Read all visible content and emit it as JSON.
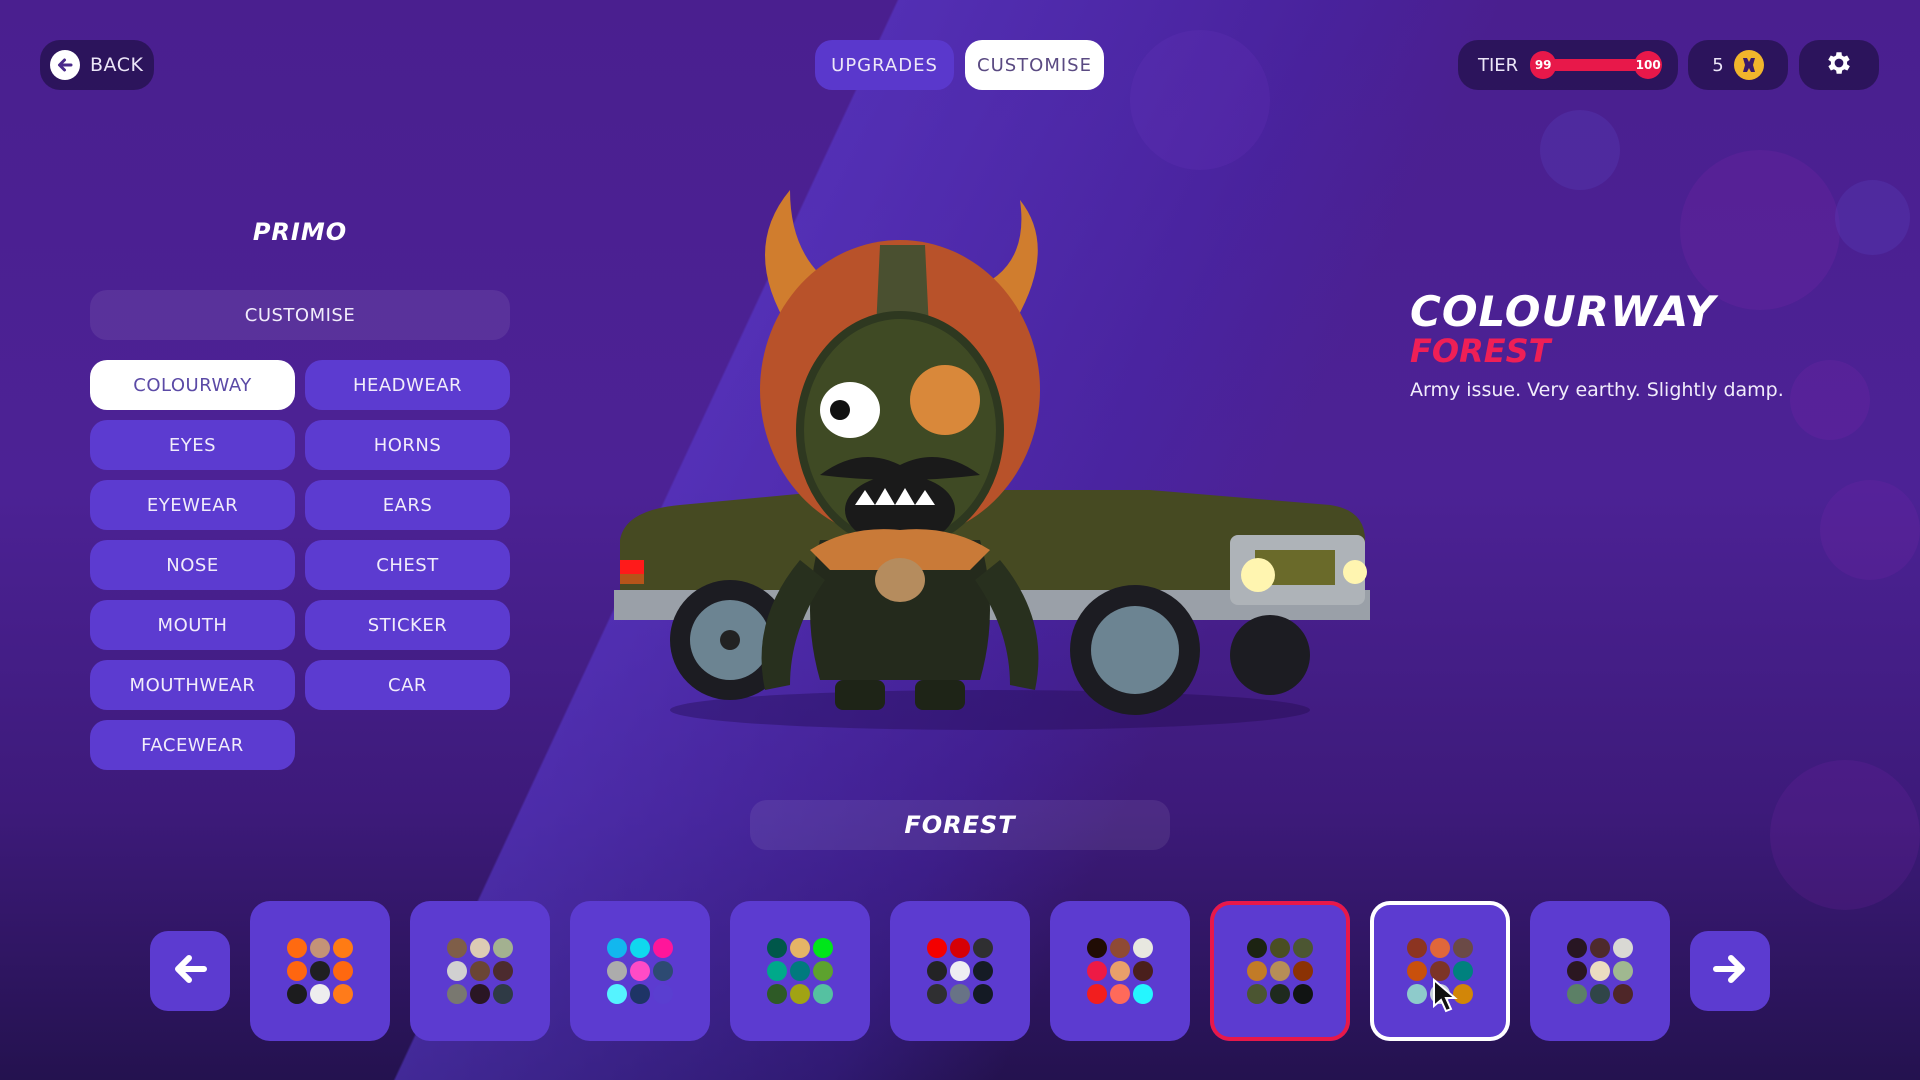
{
  "header": {
    "back_label": "BACK",
    "tabs": [
      {
        "label": "UPGRADES",
        "active": false
      },
      {
        "label": "CUSTOMISE",
        "active": true
      }
    ],
    "tier": {
      "label": "TIER",
      "current": "99",
      "next": "100",
      "progress": 1.0
    },
    "coins": "5",
    "icons": {
      "back": "arrow-left-circle-icon",
      "coin": "coin-icon",
      "settings": "gear-icon"
    }
  },
  "left_panel": {
    "character_name": "PRIMO",
    "section_label": "CUSTOMISE",
    "categories": [
      {
        "label": "COLOURWAY",
        "active": true
      },
      {
        "label": "HEADWEAR",
        "active": false
      },
      {
        "label": "EYES",
        "active": false
      },
      {
        "label": "HORNS",
        "active": false
      },
      {
        "label": "EYEWEAR",
        "active": false
      },
      {
        "label": "EARS",
        "active": false
      },
      {
        "label": "NOSE",
        "active": false
      },
      {
        "label": "CHEST",
        "active": false
      },
      {
        "label": "MOUTH",
        "active": false
      },
      {
        "label": "STICKER",
        "active": false
      },
      {
        "label": "MOUTHWEAR",
        "active": false
      },
      {
        "label": "CAR",
        "active": false
      },
      {
        "label": "FACEWEAR",
        "active": false
      }
    ]
  },
  "detail": {
    "title": "COLOURWAY",
    "subtitle": "FOREST",
    "description": "Army issue. Very earthy. Slightly damp."
  },
  "scene": {
    "description": "horned monster character in helmet standing in front of olive green car"
  },
  "selected_name": "FOREST",
  "colors": {
    "accent_red": "#e8184a",
    "button_purple": "#5c3bd0",
    "coin_gold": "#f1b52c"
  },
  "swatches": [
    {
      "state": "normal",
      "colors": [
        "#ff6a10",
        "#c49377",
        "#ff7b14",
        "#ff6610",
        "#1f1f22",
        "#ff6810",
        "#1c1c1e",
        "#eeeeee",
        "#ff7b1a"
      ]
    },
    {
      "state": "normal",
      "colors": [
        "#7f5e48",
        "#dccbb4",
        "#a3b190",
        "#d1d1d1",
        "#6a4535",
        "#4c2b2e",
        "#797870",
        "#2a1624",
        "#2f3a45"
      ]
    },
    {
      "state": "normal",
      "colors": [
        "#12b7ee",
        "#10d8ee",
        "#ff169a",
        "#acacac",
        "#ff4bc6",
        "#2d4a72",
        "#55f3ff",
        "#1e3466",
        "#5a3ed0"
      ]
    },
    {
      "state": "normal",
      "colors": [
        "#00574a",
        "#e5b466",
        "#00e61a",
        "#00a98a",
        "#007a7e",
        "#5da22e",
        "#2e5a26",
        "#a1a314",
        "#55c1a1"
      ]
    },
    {
      "state": "normal",
      "colors": [
        "#f40000",
        "#d60006",
        "#2f2f31",
        "#232325",
        "#eeeef2",
        "#151b25",
        "#2f2f31",
        "#687386",
        "#141a24"
      ]
    },
    {
      "state": "normal",
      "colors": [
        "#200c05",
        "#8f4a34",
        "#e8e8e0",
        "#ee1a45",
        "#e9a06a",
        "#4a1f1c",
        "#f21e1e",
        "#ff6a5a",
        "#25f6ff"
      ]
    },
    {
      "state": "equipped",
      "colors": [
        "#1c2312",
        "#4a4e22",
        "#4c5632",
        "#c27b27",
        "#b68e57",
        "#8b3204",
        "#4b5531",
        "#1f2a1e",
        "#111413"
      ]
    },
    {
      "state": "hovered",
      "colors": [
        "#8c3421",
        "#e0673a",
        "#6b4a46",
        "#c9500c",
        "#7c3427",
        "#00817e",
        "#8ecbcb",
        "#c8d2dc",
        "#d28608"
      ]
    },
    {
      "state": "normal",
      "colors": [
        "#281623",
        "#4e2a2c",
        "#d9d9d4",
        "#2b1721",
        "#ebdcc1",
        "#a0b890",
        "#5c8066",
        "#304548",
        "#4e2628"
      ]
    }
  ]
}
